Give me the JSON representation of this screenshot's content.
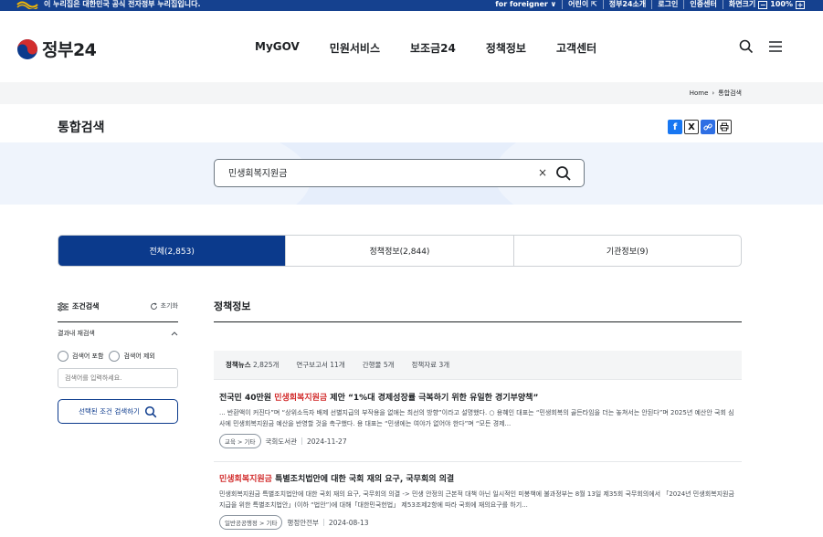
{
  "gov_strip": {
    "text": "이 누리집은 대한민국 공식 전자정부 누리집입니다.",
    "util": [
      "for foreigner ∨",
      "어린이 ⇱",
      "정부24소개",
      "로그인",
      "인증센터",
      "화면크기",
      "100%"
    ],
    "zoom_minus": "−",
    "zoom_plus": "+"
  },
  "header": {
    "logo": "정부24",
    "nav": [
      "MyGOV",
      "민원서비스",
      "보조금24",
      "정책정보",
      "고객센터"
    ]
  },
  "breadcrumb": {
    "home": "Home",
    "sep": "›",
    "current": "통합검색"
  },
  "page": {
    "title": "통합검색"
  },
  "share": {
    "facebook": "f",
    "x": "X",
    "link": "🔗",
    "print": "⎙"
  },
  "search": {
    "query": "민생회복지원금",
    "clear": "×"
  },
  "tabs": [
    "전체(2,853)",
    "정책정보(2,844)",
    "기관정보(9)"
  ],
  "filter": {
    "title": "조건검색",
    "reset": "초기화",
    "within_label": "결과내 재검색",
    "options": [
      "검색어 포함",
      "검색어 제외"
    ],
    "input_placeholder": "검색어를 입력하세요.",
    "button": "선택된 조건 검색하기"
  },
  "section": {
    "title": "정책정보"
  },
  "subtabs": [
    {
      "label": "정책뉴스",
      "count": "2,825개"
    },
    {
      "label": "연구보고서",
      "count": "11개"
    },
    {
      "label": "간행물",
      "count": "5개"
    },
    {
      "label": "정책자료",
      "count": "3개"
    }
  ],
  "results": [
    {
      "title_pre": "전국민 40만원 ",
      "title_hl": "민생회복지원금",
      "title_post": " 제안 “1%대 경제성장률 극복하기 위한 유일한 경기부양책”",
      "desc": "... 반환액이 커진다”며 “상위소득자 배제 선별지급의 부작용을 없애는 최선의 방향”이라고 설명했다. ○ 용혜인 대표는 “민생회복의 골든타임을 더는 놓쳐서는 안된다”며 2025년 예산안 국회 심사에 민생회복지원금 예산을 반영할 것을 촉구했다. 용 대표는 “민생에는 여야가 없어야 한다”며 “모든 경제...",
      "tag": "교육 > 기타",
      "org": "국회도서관",
      "date": "2024-11-27"
    },
    {
      "title_pre": "",
      "title_hl": "민생회복지원금",
      "title_post": " 특별조치법안에 대한 국회 재의 요구, 국무회의 의결",
      "desc": "민생회복지원금 특별조치법안에 대한 국회 재의 요구, 국무회의 의결 -> 민생 안정의 근본적 대책 아닌 일시적인 미봉책에 불과정부는 8월 13일 제35회 국무회의에서 「2024년 민생회복지원금 지급을 위한 특별조치법안」(이하 “법안”)에 대해「대한민국헌법」 제53조제2항에 따라 국회에 재의요구를 하기...",
      "tag": "일반공공행정 > 기타",
      "org": "행정안전부",
      "date": "2024-08-13"
    }
  ]
}
